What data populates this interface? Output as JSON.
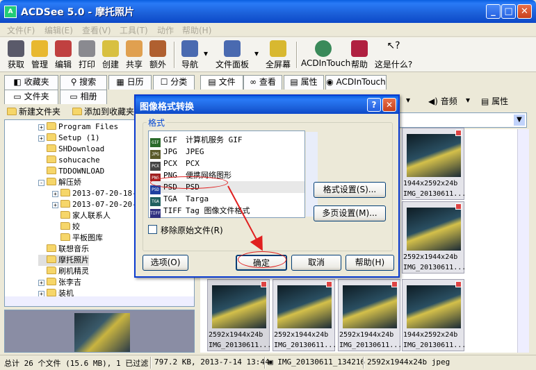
{
  "window": {
    "title": "ACDSee 5.0 - 摩托照片",
    "min": "_",
    "max": "□",
    "close": "✕"
  },
  "menu": [
    "文件(F)",
    "编辑(E)",
    "查看(V)",
    "工具(T)",
    "动作",
    "帮助(H)"
  ],
  "toolbar": [
    "获取",
    "管理",
    "编辑",
    "打印",
    "创建",
    "共享",
    "额外",
    "导航",
    "文件面板",
    "全屏幕",
    "ACDInTouch",
    "帮助",
    "这是什么?"
  ],
  "left": {
    "tabs": [
      "收藏夹",
      "搜索",
      "日历",
      "分类",
      "文件夹",
      "相册"
    ],
    "new_folder": "新建文件夹",
    "add_fav": "添加到收藏夹",
    "tree": [
      {
        "label": "Program Files",
        "exp": "+",
        "lvl": 0
      },
      {
        "label": "Setup (1)",
        "exp": "+",
        "lvl": 0
      },
      {
        "label": "SHDownload",
        "exp": "",
        "lvl": 0
      },
      {
        "label": "sohucache",
        "exp": "",
        "lvl": 0
      },
      {
        "label": "TDDOWNLOAD",
        "exp": "",
        "lvl": 0
      },
      {
        "label": "解压娇",
        "exp": "-",
        "lvl": 0
      },
      {
        "label": "2013-07-20-18-",
        "exp": "+",
        "lvl": 1
      },
      {
        "label": "2013-07-20-20-",
        "exp": "+",
        "lvl": 1
      },
      {
        "label": "家人联系人",
        "exp": "",
        "lvl": 1
      },
      {
        "label": "姣",
        "exp": "",
        "lvl": 1
      },
      {
        "label": "平板图库",
        "exp": "",
        "lvl": 1
      },
      {
        "label": "联想音乐",
        "exp": "",
        "lvl": 0
      },
      {
        "label": "摩托照片",
        "exp": "",
        "lvl": 0
      },
      {
        "label": "刷机精灵",
        "exp": "",
        "lvl": 0
      },
      {
        "label": "张李吉",
        "exp": "+",
        "lvl": 0
      },
      {
        "label": "装机",
        "exp": "+",
        "lvl": 0
      }
    ]
  },
  "right": {
    "tabs": [
      "文件",
      "查看",
      "属性",
      "ACDInTouch"
    ],
    "audio": "音频",
    "props": "属性",
    "thumbs": [
      {
        "dim": "1944x2592x24b",
        "name": "IMG_20130611..."
      },
      {
        "dim": "2592x1944x24b",
        "name": "IMG_20130611..."
      },
      {
        "dim": "2592x1944x24b",
        "name": "IMG_20130611..."
      },
      {
        "dim": "2592x1944x24b",
        "name": "IMG_20130611..."
      },
      {
        "dim": "2592x1944x24b",
        "name": "IMG_20130611..."
      },
      {
        "dim": "2592x1944x24b",
        "name": "IMG_20130611..."
      },
      {
        "dim": "1944x2592x24b",
        "name": "IMG_20130611..."
      }
    ]
  },
  "status": [
    "总计 26 个文件 (15.6 MB), 1 已过滤",
    "797.2 KB, 2013-7-14 13:44",
    "IMG_20130611_134216",
    "2592x1944x24b jpeg"
  ],
  "dialog": {
    "title": "图像格式转换",
    "help": "?",
    "close": "✕",
    "group": "格式",
    "formats": [
      {
        "ext": "GIF",
        "desc": "计算机服务 GIF",
        "bg": "#2a6a2a"
      },
      {
        "ext": "JPG",
        "desc": "JPEG",
        "bg": "#5a5a2a"
      },
      {
        "ext": "PCX",
        "desc": "PCX",
        "bg": "#444"
      },
      {
        "ext": "PNG",
        "desc": "便携网络图形",
        "bg": "#a02020"
      },
      {
        "ext": "PSD",
        "desc": "PSD",
        "bg": "#2040a0"
      },
      {
        "ext": "TGA",
        "desc": "Targa",
        "bg": "#206060"
      },
      {
        "ext": "TIFF",
        "desc": "Tag 图像文件格式",
        "bg": "#303080"
      }
    ],
    "format_settings": "格式设置(S)...",
    "multipage": "多页设置(M)...",
    "remove_original": "移除原始文件(R)",
    "options": "选项(O)",
    "ok": "确定",
    "cancel": "取消",
    "help_btn": "帮助(H)"
  }
}
